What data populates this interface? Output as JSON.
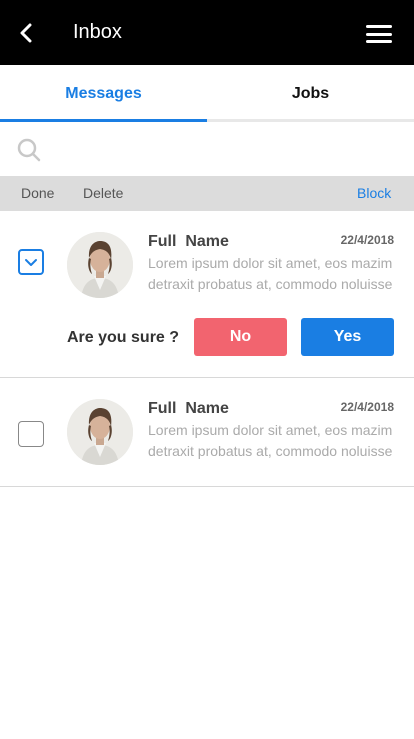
{
  "header": {
    "title": "Inbox",
    "back_icon": "chevron-left-icon",
    "menu_icon": "hamburger-menu-icon"
  },
  "tabs": [
    {
      "label": "Messages",
      "active": true
    },
    {
      "label": "Jobs",
      "active": false
    }
  ],
  "search": {
    "icon": "search-icon",
    "placeholder": ""
  },
  "actions": {
    "done": "Done",
    "delete": "Delete",
    "block": "Block"
  },
  "messages": [
    {
      "name": "Full  Name",
      "date": "22/4/2018",
      "preview": "Lorem ipsum dolor sit amet, eos mazim detraxit probatus at, commodo noluisse",
      "checked": true,
      "confirm": {
        "question": "Are you sure ?",
        "no_label": "No",
        "yes_label": "Yes"
      }
    },
    {
      "name": "Full  Name",
      "date": "22/4/2018",
      "preview": "Lorem ipsum dolor sit amet, eos mazim detraxit probatus at, commodo noluisse",
      "checked": false
    }
  ],
  "colors": {
    "accent": "#1a7ee3",
    "danger": "#f2646f",
    "header_bg": "#000000",
    "action_bar_bg": "#dcdcdc"
  }
}
